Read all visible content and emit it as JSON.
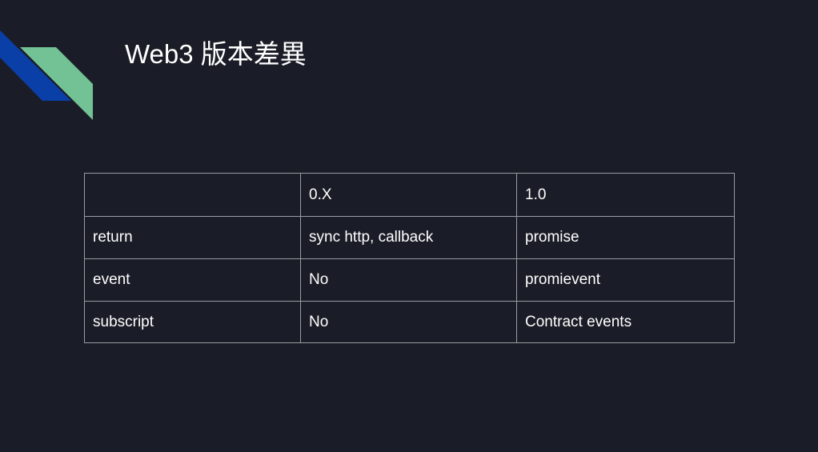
{
  "slide": {
    "title": "Web3 版本差異",
    "accent_colors": {
      "background": "#1a1d27",
      "deco_blue": "#0b3fa8",
      "deco_green": "#72c295",
      "table_border": "#9a9ca3",
      "text": "#ffffff"
    }
  },
  "table": {
    "rows": [
      [
        "",
        "0.X",
        "1.0"
      ],
      [
        "return",
        "sync http, callback",
        "promise"
      ],
      [
        "event",
        "No",
        "promievent"
      ],
      [
        "subscript",
        "No",
        "Contract events"
      ]
    ]
  }
}
